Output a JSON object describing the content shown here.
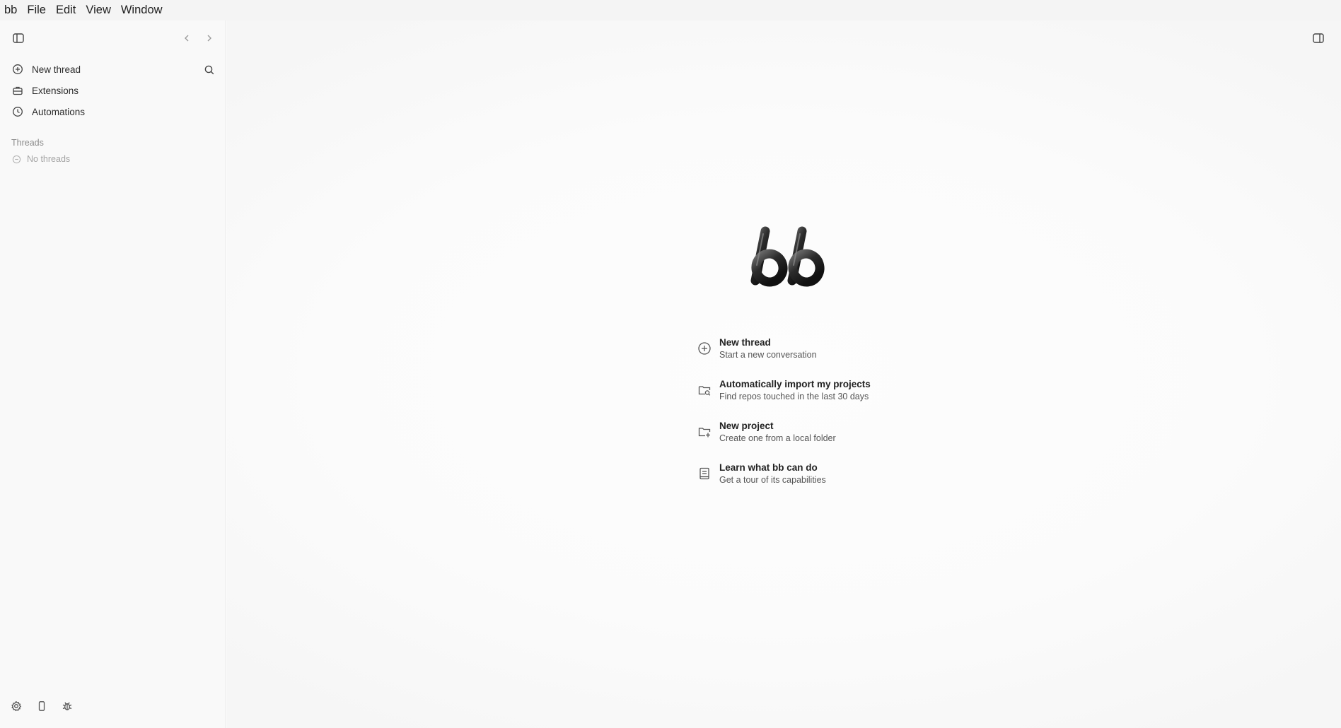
{
  "menubar": {
    "items": [
      "bb",
      "File",
      "Edit",
      "View",
      "Window"
    ]
  },
  "sidebar": {
    "toggle_icon": "sidebar-left-icon",
    "back_icon": "chevron-left-icon",
    "forward_icon": "chevron-right-icon",
    "items": [
      {
        "label": "New thread",
        "icon": "plus-circle-icon"
      },
      {
        "label": "Extensions",
        "icon": "briefcase-icon"
      },
      {
        "label": "Automations",
        "icon": "clock-icon"
      }
    ],
    "search_icon": "search-icon",
    "threads_heading": "Threads",
    "empty_label": "No threads",
    "bottom_icons": [
      "gear-icon",
      "phone-icon",
      "bug-icon"
    ]
  },
  "main": {
    "logo_text": "bb",
    "right_toggle_icon": "sidebar-right-icon",
    "actions": [
      {
        "title": "New thread",
        "subtitle": "Start a new conversation",
        "icon": "plus-circle-icon"
      },
      {
        "title": "Automatically import my projects",
        "subtitle": "Find repos touched in the last 30 days",
        "icon": "folder-search-icon"
      },
      {
        "title": "New project",
        "subtitle": "Create one from a local folder",
        "icon": "folder-plus-icon"
      },
      {
        "title": "Learn what bb can do",
        "subtitle": "Get a tour of its capabilities",
        "icon": "book-icon"
      }
    ]
  },
  "colors": {
    "menubar_bg": "#f4f4f4",
    "sidebar_bg": "#f9f9f9",
    "main_bg": "#fbfbfb",
    "text_primary": "#1f1f1f",
    "text_muted": "#8a8a8a"
  }
}
